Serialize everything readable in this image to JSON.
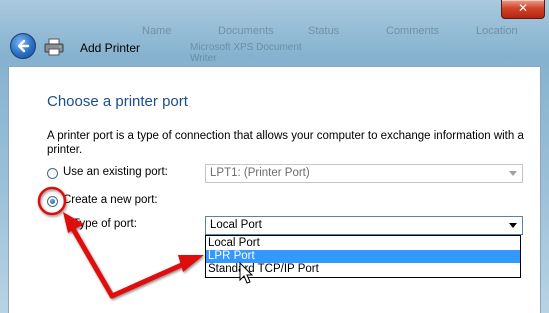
{
  "window": {
    "title": "Add Printer",
    "close_symbol": "✕",
    "background_tabs": [
      "Name",
      "Documents",
      "Status",
      "Comments",
      "Location"
    ],
    "background_doc": [
      "Microsoft XPS Document",
      "Writer"
    ]
  },
  "page": {
    "heading": "Choose a printer port",
    "description": "A printer port is a type of connection that allows your computer to exchange information with a printer."
  },
  "options": {
    "existing_label": "Use an existing port:",
    "existing_value": "LPT1: (Printer Port)",
    "new_label": "Create a new port:",
    "type_label": "Type of port:",
    "type_value": "Local Port",
    "selected": "new"
  },
  "dropdown": {
    "items": [
      "Local Port",
      "LPR Port",
      "Standard TCP/IP Port"
    ],
    "highlighted_index": 1
  },
  "colors": {
    "heading": "#1e4e8c",
    "highlight": "#3399ff",
    "annotation": "#e01010"
  },
  "icons": [
    "back-arrow-icon",
    "printer-icon",
    "close-icon",
    "mouse-cursor-icon"
  ]
}
